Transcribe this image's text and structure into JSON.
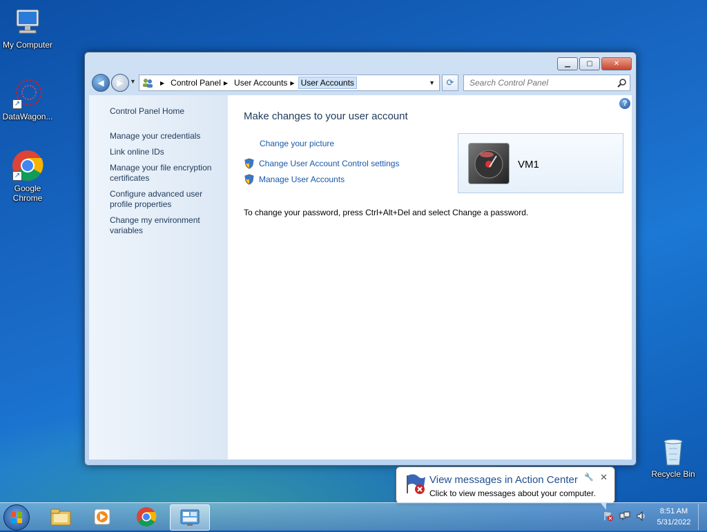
{
  "desktop": {
    "icons": [
      {
        "label": "My Computer",
        "icon": "computer-icon"
      },
      {
        "label": "DataWagon...",
        "icon": "datawagon-icon"
      },
      {
        "label": "Google Chrome",
        "icon": "chrome-icon"
      },
      {
        "label": "Recycle Bin",
        "icon": "recycle-bin-icon"
      }
    ]
  },
  "window": {
    "breadcrumb": [
      "Control Panel",
      "User Accounts",
      "User Accounts"
    ],
    "search_placeholder": "Search Control Panel",
    "sidebar": {
      "home": "Control Panel Home",
      "links": [
        "Manage your credentials",
        "Link online IDs",
        "Manage your file encryption certificates",
        "Configure advanced user profile properties",
        "Change my environment variables"
      ]
    },
    "main": {
      "heading": "Make changes to your user account",
      "tasks": [
        {
          "label": "Change your picture",
          "shield": false
        },
        {
          "label": "Change User Account Control settings",
          "shield": true
        },
        {
          "label": "Manage User Accounts",
          "shield": true
        }
      ],
      "note": "To change your password, press Ctrl+Alt+Del and select Change a password.",
      "user_name": "VM1"
    }
  },
  "balloon": {
    "title": "View messages in Action Center",
    "body": "Click to view messages about your computer."
  },
  "taskbar": {
    "time": "8:51 AM",
    "date": "5/31/2022"
  },
  "colors": {
    "link": "#1a58a8",
    "heading": "#1e395b",
    "desktop": "#1a6cc8"
  }
}
